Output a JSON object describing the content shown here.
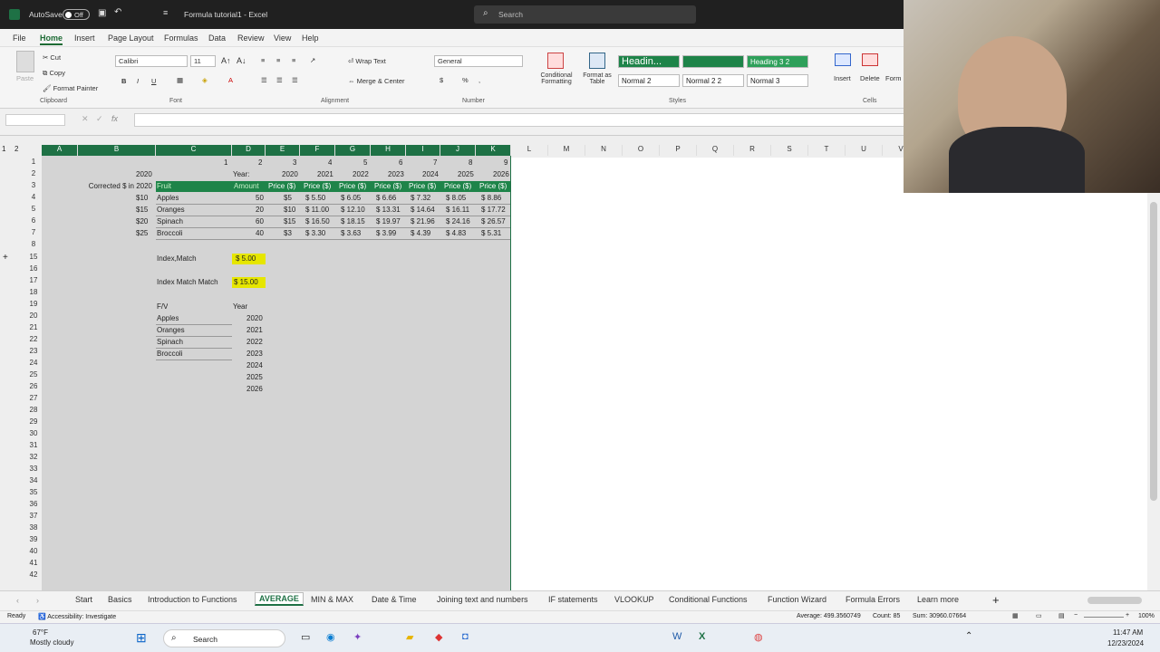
{
  "window": {
    "autosave_label": "AutoSave",
    "autosave_state": "Off",
    "file_title": "Formula tutorial1 - Excel",
    "search_placeholder": "Search"
  },
  "menu": [
    "File",
    "Home",
    "Insert",
    "Page Layout",
    "Formulas",
    "Data",
    "Review",
    "View",
    "Help"
  ],
  "ribbon": {
    "clipboard": {
      "paste": "Paste",
      "cut": "Cut",
      "copy": "Copy",
      "format_painter": "Format Painter",
      "group": "Clipboard"
    },
    "font": {
      "name": "Calibri",
      "size": "11",
      "group": "Font"
    },
    "alignment": {
      "wrap": "Wrap Text",
      "merge": "Merge & Center",
      "group": "Alignment"
    },
    "number": {
      "format": "General",
      "group": "Number"
    },
    "styles": {
      "conditional": "Conditional Formatting",
      "format_table": "Format as Table",
      "heading": "Headin...",
      "heading32": "Heading 3 2",
      "normal2": "Normal 2",
      "normal22": "Normal 2 2",
      "normal3": "Normal 3",
      "group": "Styles"
    },
    "cells": {
      "insert": "Insert",
      "delete": "Delete",
      "format": "Form",
      "group": "Cells"
    }
  },
  "columns": [
    "A",
    "B",
    "C",
    "D",
    "E",
    "F",
    "G",
    "H",
    "I",
    "J",
    "K",
    "L",
    "M",
    "N",
    "O",
    "P",
    "Q",
    "R",
    "S",
    "T",
    "U",
    "V"
  ],
  "rows": [
    "1",
    "2",
    "3",
    "4",
    "5",
    "6",
    "7",
    "8",
    "15",
    "16",
    "17",
    "18",
    "19",
    "20",
    "21",
    "22",
    "23",
    "24",
    "25",
    "26",
    "27",
    "28",
    "29",
    "30",
    "31",
    "32",
    "33",
    "34",
    "35",
    "36",
    "37",
    "38",
    "39",
    "40",
    "41",
    "42"
  ],
  "grid": {
    "r1": [
      "1",
      "2",
      "3",
      "4",
      "5",
      "6",
      "7",
      "8",
      "9"
    ],
    "b2": "2020",
    "d2": "Year:",
    "r2": [
      "2020",
      "2021",
      "2022",
      "2023",
      "2024",
      "2025",
      "2026"
    ],
    "b3": "Corrected $ in 2020",
    "c3": "Fruit",
    "d3": "Amount",
    "r3": [
      "Price ($)",
      "Price ($)",
      "Price ($)",
      "Price ($)",
      "Price ($)",
      "Price ($)",
      "Price ($)"
    ],
    "data": [
      {
        "b": "$10",
        "c": "Apples",
        "d": "50",
        "e": "$5",
        "f": "$ 5.50",
        "g": "$ 6.05",
        "h": "$ 6.66",
        "i": "$ 7.32",
        "j": "$ 8.05",
        "k": "$ 8.86"
      },
      {
        "b": "$15",
        "c": "Oranges",
        "d": "20",
        "e": "$10",
        "f": "$ 11.00",
        "g": "$ 12.10",
        "h": "$ 13.31",
        "i": "$ 14.64",
        "j": "$ 16.11",
        "k": "$ 17.72"
      },
      {
        "b": "$20",
        "c": "Spinach",
        "d": "60",
        "e": "$15",
        "f": "$ 16.50",
        "g": "$ 18.15",
        "h": "$ 19.97",
        "i": "$ 21.96",
        "j": "$ 24.16",
        "k": "$ 26.57"
      },
      {
        "b": "$25",
        "c": "Broccoli",
        "d": "40",
        "e": "$3",
        "f": "$ 3.30",
        "g": "$ 3.63",
        "h": "$ 3.99",
        "i": "$ 4.39",
        "j": "$ 4.83",
        "k": "$ 5.31"
      }
    ],
    "index_match_label": "Index,Match",
    "index_match_value": "$ 5.00",
    "imm_label": "Index Match Match",
    "imm_value": "$ 15.00",
    "fv_label": "F/V",
    "year_label": "Year",
    "fv_items": [
      "Apples",
      "Oranges",
      "Spinach",
      "Broccoli"
    ],
    "years": [
      "2020",
      "2021",
      "2022",
      "2023",
      "2024",
      "2025",
      "2026"
    ]
  },
  "sheet_tabs": [
    "Start",
    "Basics",
    "Introduction to Functions",
    "AVERAGE",
    "MIN & MAX",
    "Date & Time",
    "Joining text and numbers",
    "IF statements",
    "VLOOKUP",
    "Conditional Functions",
    "Function Wizard",
    "Formula Errors",
    "Learn more"
  ],
  "active_sheet": "AVERAGE",
  "status": {
    "ready": "Ready",
    "accessibility": "Accessibility: Investigate",
    "average": "Average: 499.3560749",
    "count": "Count: 85",
    "sum": "Sum: 30960.07664",
    "zoom": "100%"
  },
  "taskbar": {
    "temp": "67°F",
    "weather": "Mostly cloudy",
    "search": "Search",
    "time": "11:47 AM",
    "date": "12/23/2024"
  }
}
